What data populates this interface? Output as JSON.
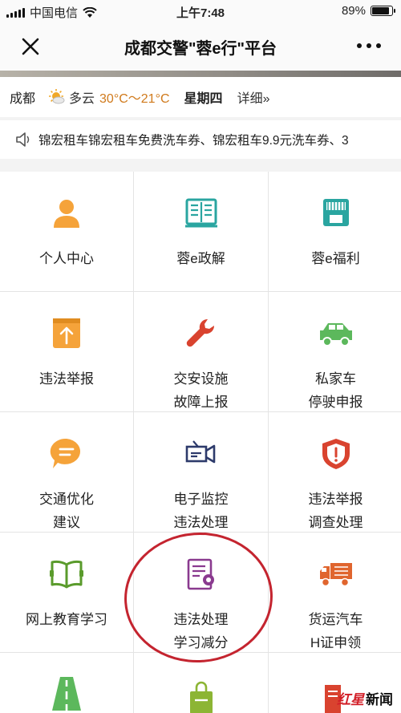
{
  "status_bar": {
    "carrier": "中国电信",
    "time": "上午7:48",
    "battery": "89%",
    "battery_level": 0.89
  },
  "nav": {
    "title": "成都交警\"蓉e行\"平台"
  },
  "weather": {
    "city": "成都",
    "condition": "多云",
    "temperature": "30°C～21°C",
    "weekday": "星期四",
    "detail": "详细»"
  },
  "notice": {
    "text": "锦宏租车锦宏租车免费洗车券、锦宏租车9.9元洗车券、3"
  },
  "menu": [
    {
      "label_1": "个人中心",
      "label_2": "",
      "icon": "person-icon"
    },
    {
      "label_1": "蓉e政解",
      "label_2": "",
      "icon": "book-icon"
    },
    {
      "label_1": "蓉e福利",
      "label_2": "",
      "icon": "shop-icon"
    },
    {
      "label_1": "违法举报",
      "label_2": "",
      "icon": "upload-icon"
    },
    {
      "label_1": "交安设施",
      "label_2": "故障上报",
      "icon": "wrench-icon"
    },
    {
      "label_1": "私家车",
      "label_2": "停驶申报",
      "icon": "car-icon"
    },
    {
      "label_1": "交通优化",
      "label_2": "建议",
      "icon": "chat-bubble-icon"
    },
    {
      "label_1": "电子监控",
      "label_2": "违法处理",
      "icon": "camera-icon"
    },
    {
      "label_1": "违法举报",
      "label_2": "调查处理",
      "icon": "shield-alert-icon"
    },
    {
      "label_1": "网上教育学习",
      "label_2": "",
      "icon": "open-book-icon"
    },
    {
      "label_1": "违法处理",
      "label_2": "学习减分",
      "icon": "certificate-icon"
    },
    {
      "label_1": "货运汽车",
      "label_2": "H证申领",
      "icon": "truck-icon"
    }
  ],
  "watermark": {
    "red": "红星",
    "black": "新闻"
  },
  "colors": {
    "orange": "#f5a33a",
    "teal": "#2aa5a0",
    "red": "#d9432f",
    "green": "#5cb85c",
    "navy": "#2d3a6b",
    "purple": "#8a3a8f",
    "temp": "#d07a1c"
  }
}
